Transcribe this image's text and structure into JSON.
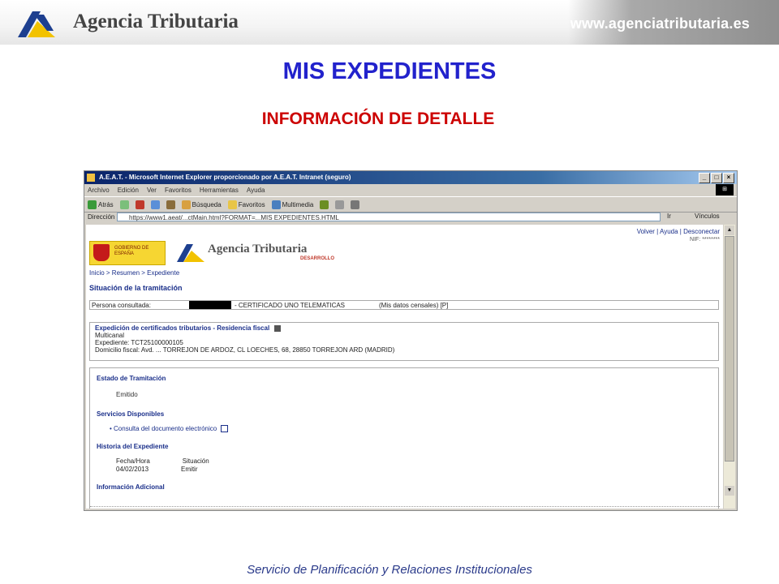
{
  "header": {
    "brand": "Agencia Tributaria",
    "url": "www.agenciatributaria.es"
  },
  "title": "MIS EXPEDIENTES",
  "subtitle": "INFORMACIÓN DE DETALLE",
  "footer": "Servicio de Planificación y Relaciones Institucionales",
  "colors": {
    "title": "#2222cc",
    "subtitle": "#cc0000",
    "footer": "#2a3a8a",
    "ie_titlebar": "#0a246a"
  },
  "browser": {
    "title": "A.E.A.T. - Microsoft Internet Explorer proporcionado por A.E.A.T. Intranet (seguro)",
    "menu": [
      "Archivo",
      "Edición",
      "Ver",
      "Favoritos",
      "Herramientas",
      "Ayuda"
    ],
    "toolbar": [
      "Atrás",
      "Búsqueda",
      "Favoritos",
      "Multimedia"
    ],
    "address_label": "Dirección",
    "address": "https://www1.aeat/...ctMain.html?FORMAT=...MIS EXPEDIENTES.HTML",
    "go_label": "Ir",
    "links_label": "Vínculos",
    "page": {
      "top_links": "Volver | Ayuda | Desconectar",
      "nif": "NIF: ********",
      "gov_text": "GOBIERNO DE ESPAÑA",
      "logo_text": "Agencia Tributaria",
      "logo_sub": "DESARROLLO",
      "breadcrumb": "Inicio > Resumen > Expediente",
      "situation_title": "Situación de la tramitación",
      "person_label": "Persona consultada:",
      "person_value": "- CERTIFICADO UNO TELEMATICAS",
      "person_data": "(Mis datos censales) [P]",
      "expedition_title": "Expedición de certificados tributarios - Residencia fiscal",
      "expedition_lines": [
        "Multicanal",
        "Expediente: TCT25100000105",
        "Domicilio fiscal: Avd. ... TORREJON DE ARDOZ, CL LOECHES, 68, 28850 TORREJON ARD (MADRID)"
      ],
      "status_title": "Estado de Tramitación",
      "status_value": "Emitido",
      "services_title": "Servicios Disponibles",
      "service_item": "Consulta del documento electrónico",
      "history_title": "Historia del Expediente",
      "history_rows": [
        {
          "date": "Fecha/Hora",
          "event": "Situación"
        },
        {
          "date": "04/02/2013",
          "event": "Emitir"
        }
      ],
      "additional_title": "Información Adicional"
    }
  }
}
